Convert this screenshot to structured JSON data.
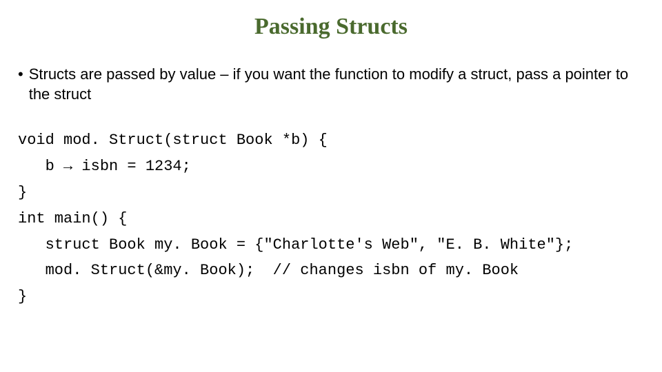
{
  "title": "Passing Structs",
  "bullet": {
    "marker": "•",
    "text": "Structs are passed by value – if you want the function to modify a struct, pass a pointer to the struct"
  },
  "code": {
    "line1": "void mod. Struct(struct Book *b) {",
    "line2": "   b → isbn = 1234;",
    "line3": "}",
    "line4": "int main() {",
    "line5": "   struct Book my. Book = {\"Charlotte's Web\", \"E. B. White\"};",
    "line6": "   mod. Struct(&my. Book);  // changes isbn of my. Book",
    "line7": "}"
  }
}
